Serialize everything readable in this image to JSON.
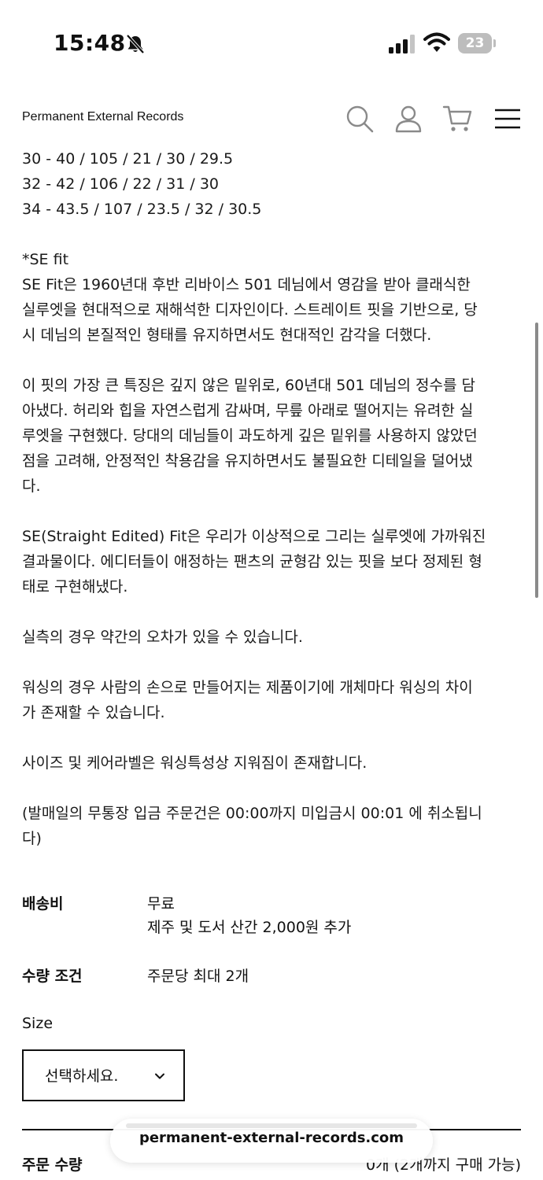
{
  "status_bar": {
    "time": "15:48",
    "battery": "23"
  },
  "header": {
    "brand": "Permanent External Records",
    "icons": [
      "search-icon",
      "account-icon",
      "cart-icon",
      "menu-icon"
    ]
  },
  "description": {
    "size_rows": [
      "30 - 40 / 105 / 21 / 30 / 29.5",
      "32 - 42 / 106 / 22 / 31 / 30",
      "34 - 43.5 / 107 / 23.5 / 32 / 30.5"
    ],
    "fit_title": "*SE fit",
    "fit_para1": [
      "SE Fit은 1960년대 후반 리바이스 501 데님에서 영감을 받아 클래식한",
      "실루엣을 현대적으로 재해석한 디자인이다. 스트레이트 핏을 기반으로, 당",
      "시 데님의 본질적인 형태를 유지하면서도 현대적인 감각을 더했다."
    ],
    "fit_para2": [
      "이 핏의 가장 큰 특징은 깊지 않은 밑위로, 60년대 501 데님의 정수를 담",
      "아냈다. 허리와 힙을 자연스럽게 감싸며, 무릎 아래로 떨어지는 유려한 실",
      "루엣을 구현했다. 당대의 데님들이 과도하게 깊은 밑위를 사용하지 않았던",
      "점을 고려해, 안정적인 착용감을 유지하면서도 불필요한 디테일을 덜어냈",
      "다."
    ],
    "fit_para3": [
      "SE(Straight Edited) Fit은 우리가 이상적으로 그리는 실루엣에 가까워진",
      "결과물이다. 에디터들이 애정하는 팬츠의 균형감 있는 핏을 보다 정제된 형",
      "태로 구현해냈다."
    ],
    "note_measure": "실측의 경우 약간의 오차가 있을 수 있습니다.",
    "note_washing": [
      "워싱의 경우 사람의 손으로 만들어지는 제품이기에 개체마다 워싱의 차이",
      "가 존재할 수 있습니다."
    ],
    "note_label": "사이즈 및 케어라벨은 워싱특성상 지워짐이 존재합니다.",
    "note_order": [
      "(발매일의 무통장 입금 주문건은 00:00까지 미입금시 00:01 에 취소됩니",
      "다)"
    ]
  },
  "shipping": {
    "label": "배송비",
    "value": "무료",
    "extra": "제주 및 도서 산간 2,000원 추가"
  },
  "quantity_condition": {
    "label": "수량 조건",
    "value": "주문당 최대 2개"
  },
  "size_option": {
    "label": "Size",
    "placeholder": "선택하세요."
  },
  "order_quantity": {
    "label": "주문 수량",
    "value": "0개 (2개까지 구매 가능)"
  },
  "browser": {
    "url": "permanent-external-records.com"
  }
}
